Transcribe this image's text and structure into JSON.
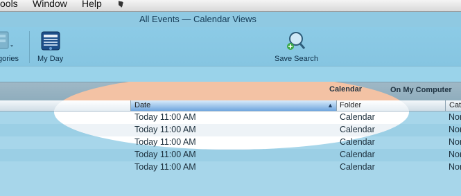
{
  "menubar": {
    "items": [
      "ools",
      "Window",
      "Help"
    ]
  },
  "window": {
    "title": "All Events — Calendar Views"
  },
  "toolbar": {
    "categories_label": "gories",
    "myday_label": "My Day",
    "savesearch_label": "Save Search"
  },
  "section": {
    "left": "Calendar",
    "right": "On My Computer"
  },
  "columns": {
    "date": "Date",
    "folder": "Folder",
    "cat": "Cat"
  },
  "rows": [
    {
      "date": "Today 11:00 AM",
      "folder": "Calendar",
      "cat": "Nor"
    },
    {
      "date": "Today 11:00 AM",
      "folder": "Calendar",
      "cat": "Nor"
    },
    {
      "date": "Today 11:00 AM",
      "folder": "Calendar",
      "cat": "Nor"
    },
    {
      "date": "Today 11:00 AM",
      "folder": "Calendar",
      "cat": "Nor"
    },
    {
      "date": "Today 11:00 AM",
      "folder": "Calendar",
      "cat": "Nor"
    }
  ]
}
